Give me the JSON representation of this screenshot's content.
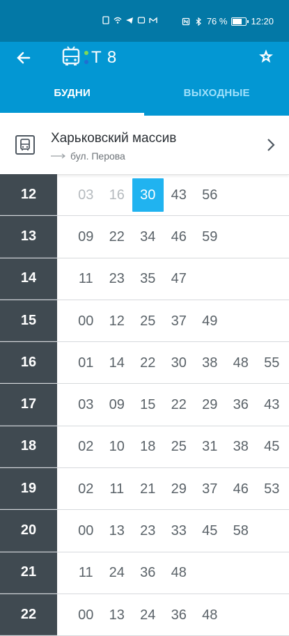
{
  "status": {
    "battery": "76 %",
    "time": "12:20"
  },
  "toolbar": {
    "route": "T 8"
  },
  "tabs": [
    {
      "label": "БУДНИ"
    },
    {
      "label": "ВЫХОДНЫЕ"
    }
  ],
  "stop": {
    "name": "Харьковский массив",
    "direction": "бул. Перова"
  },
  "schedule": [
    {
      "hour": "12",
      "minutes": [
        "03",
        "16",
        "30",
        "43",
        "56"
      ]
    },
    {
      "hour": "13",
      "minutes": [
        "09",
        "22",
        "34",
        "46",
        "59"
      ]
    },
    {
      "hour": "14",
      "minutes": [
        "11",
        "23",
        "35",
        "47"
      ]
    },
    {
      "hour": "15",
      "minutes": [
        "00",
        "12",
        "25",
        "37",
        "49"
      ]
    },
    {
      "hour": "16",
      "minutes": [
        "01",
        "14",
        "22",
        "30",
        "38",
        "48",
        "55"
      ]
    },
    {
      "hour": "17",
      "minutes": [
        "03",
        "09",
        "15",
        "22",
        "29",
        "36",
        "43"
      ]
    },
    {
      "hour": "18",
      "minutes": [
        "02",
        "10",
        "18",
        "25",
        "31",
        "38",
        "45"
      ]
    },
    {
      "hour": "19",
      "minutes": [
        "02",
        "11",
        "21",
        "29",
        "37",
        "46",
        "53"
      ]
    },
    {
      "hour": "20",
      "minutes": [
        "00",
        "13",
        "23",
        "33",
        "45",
        "58"
      ]
    },
    {
      "hour": "21",
      "minutes": [
        "11",
        "24",
        "36",
        "48"
      ]
    },
    {
      "hour": "22",
      "minutes": [
        "00",
        "13",
        "24",
        "36",
        "48"
      ]
    }
  ]
}
